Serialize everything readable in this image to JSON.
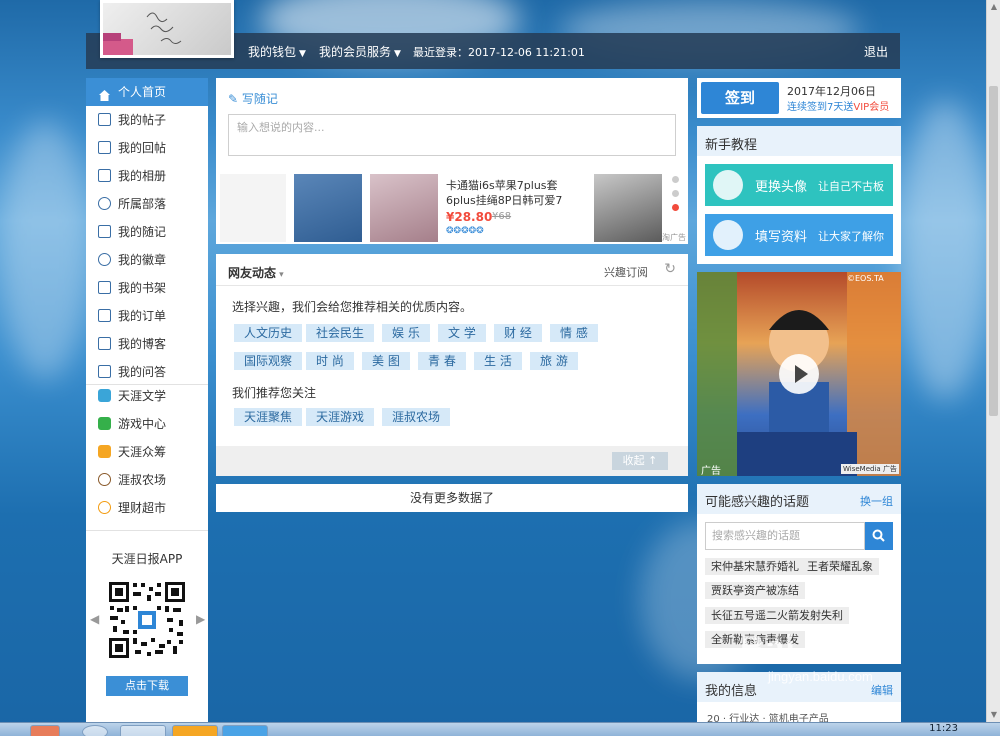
{
  "header": {
    "wallet_label": "我的钱包",
    "vip_label": "我的会员服务",
    "last_login": "最近登录：2017-12-06 11:21:01",
    "logout_label": "退出"
  },
  "sidebar": {
    "items": [
      {
        "label": "个人首页",
        "icon": "home-icon"
      },
      {
        "label": "我的帖子",
        "icon": "doc-icon"
      },
      {
        "label": "我的回帖",
        "icon": "edit-icon"
      },
      {
        "label": "我的相册",
        "icon": "photo-icon"
      },
      {
        "label": "所属部落",
        "icon": "group-icon"
      },
      {
        "label": "我的随记",
        "icon": "note-icon"
      },
      {
        "label": "我的徽章",
        "icon": "badge-icon"
      },
      {
        "label": "我的书架",
        "icon": "book-icon"
      },
      {
        "label": "我的订单",
        "icon": "order-icon"
      },
      {
        "label": "我的博客",
        "icon": "blog-icon"
      },
      {
        "label": "我的问答",
        "icon": "question-icon"
      }
    ],
    "apps": [
      {
        "label": "天涯文学",
        "icon": "literature-icon",
        "color": "#3aa5d8"
      },
      {
        "label": "游戏中心",
        "icon": "gamepad-icon",
        "color": "#35b04a"
      },
      {
        "label": "天涯众筹",
        "icon": "crowdfund-icon",
        "color": "#f5a623"
      },
      {
        "label": "涯叔农场",
        "icon": "farm-icon",
        "color": "#8a5a2b"
      },
      {
        "label": "理财超市",
        "icon": "finance-icon",
        "color": "#f39c12"
      }
    ],
    "app_title": "天涯日报APP",
    "download_label": "点击下载"
  },
  "composer": {
    "write_label": "写随记",
    "placeholder": "输入想说的内容..."
  },
  "ad": {
    "title": "卡通猫i6s苹果7plus套6plus挂绳8P日韩可爱7",
    "price": "¥28.80",
    "old_price": "¥68",
    "badge": "淘",
    "ad_label": "广告"
  },
  "feed": {
    "title": "网友动态",
    "subscribe_label": "兴趣订阅",
    "interest_prompt": "选择兴趣，我们会给您推荐相关的优质内容。",
    "interests": [
      "人文历史",
      "社会民生",
      "娱 乐",
      "文 学",
      "财 经",
      "情 感",
      "国际观察",
      "时 尚",
      "美 图",
      "青 春",
      "生 活",
      "旅 游"
    ],
    "follow_prompt": "我们推荐您关注",
    "follows": [
      "天涯聚焦",
      "天涯游戏",
      "涯叔农场"
    ],
    "collapse_label": "收起 ↑",
    "no_more": "没有更多数据了"
  },
  "checkin": {
    "button": "签到",
    "date": "2017年12月06日",
    "streak_text": "连续签到7天送",
    "vip_text": "VIP会员"
  },
  "tutorial": {
    "title": "新手教程",
    "cards": [
      {
        "big": "更换头像",
        "small": "让自己不古板"
      },
      {
        "big": "填写资料",
        "small": "让大家了解你"
      }
    ]
  },
  "video_ad": {
    "ad_label": "广告",
    "source": "WiseMedia",
    "corner": "广告",
    "watermark": "©EOS.TA"
  },
  "topics": {
    "title": "可能感兴趣的话题",
    "refresh_label": "换一组",
    "search_placeholder": "搜索感兴趣的话题",
    "items": [
      "宋仲基宋慧乔婚礼",
      "王者荣耀乱象",
      "贾跃亭资产被冻结",
      "长征五号遥二火箭发射失利",
      "全新勒索病毒爆发"
    ]
  },
  "myinfo": {
    "title": "我的信息",
    "edit_label": "编辑",
    "line": "20 · 行业达 · 篮机电子产品"
  },
  "taskbar": {
    "clock": "11:23"
  },
  "watermark": {
    "brand": "Bai  经验",
    "url": "jingyan.baidu.com"
  }
}
